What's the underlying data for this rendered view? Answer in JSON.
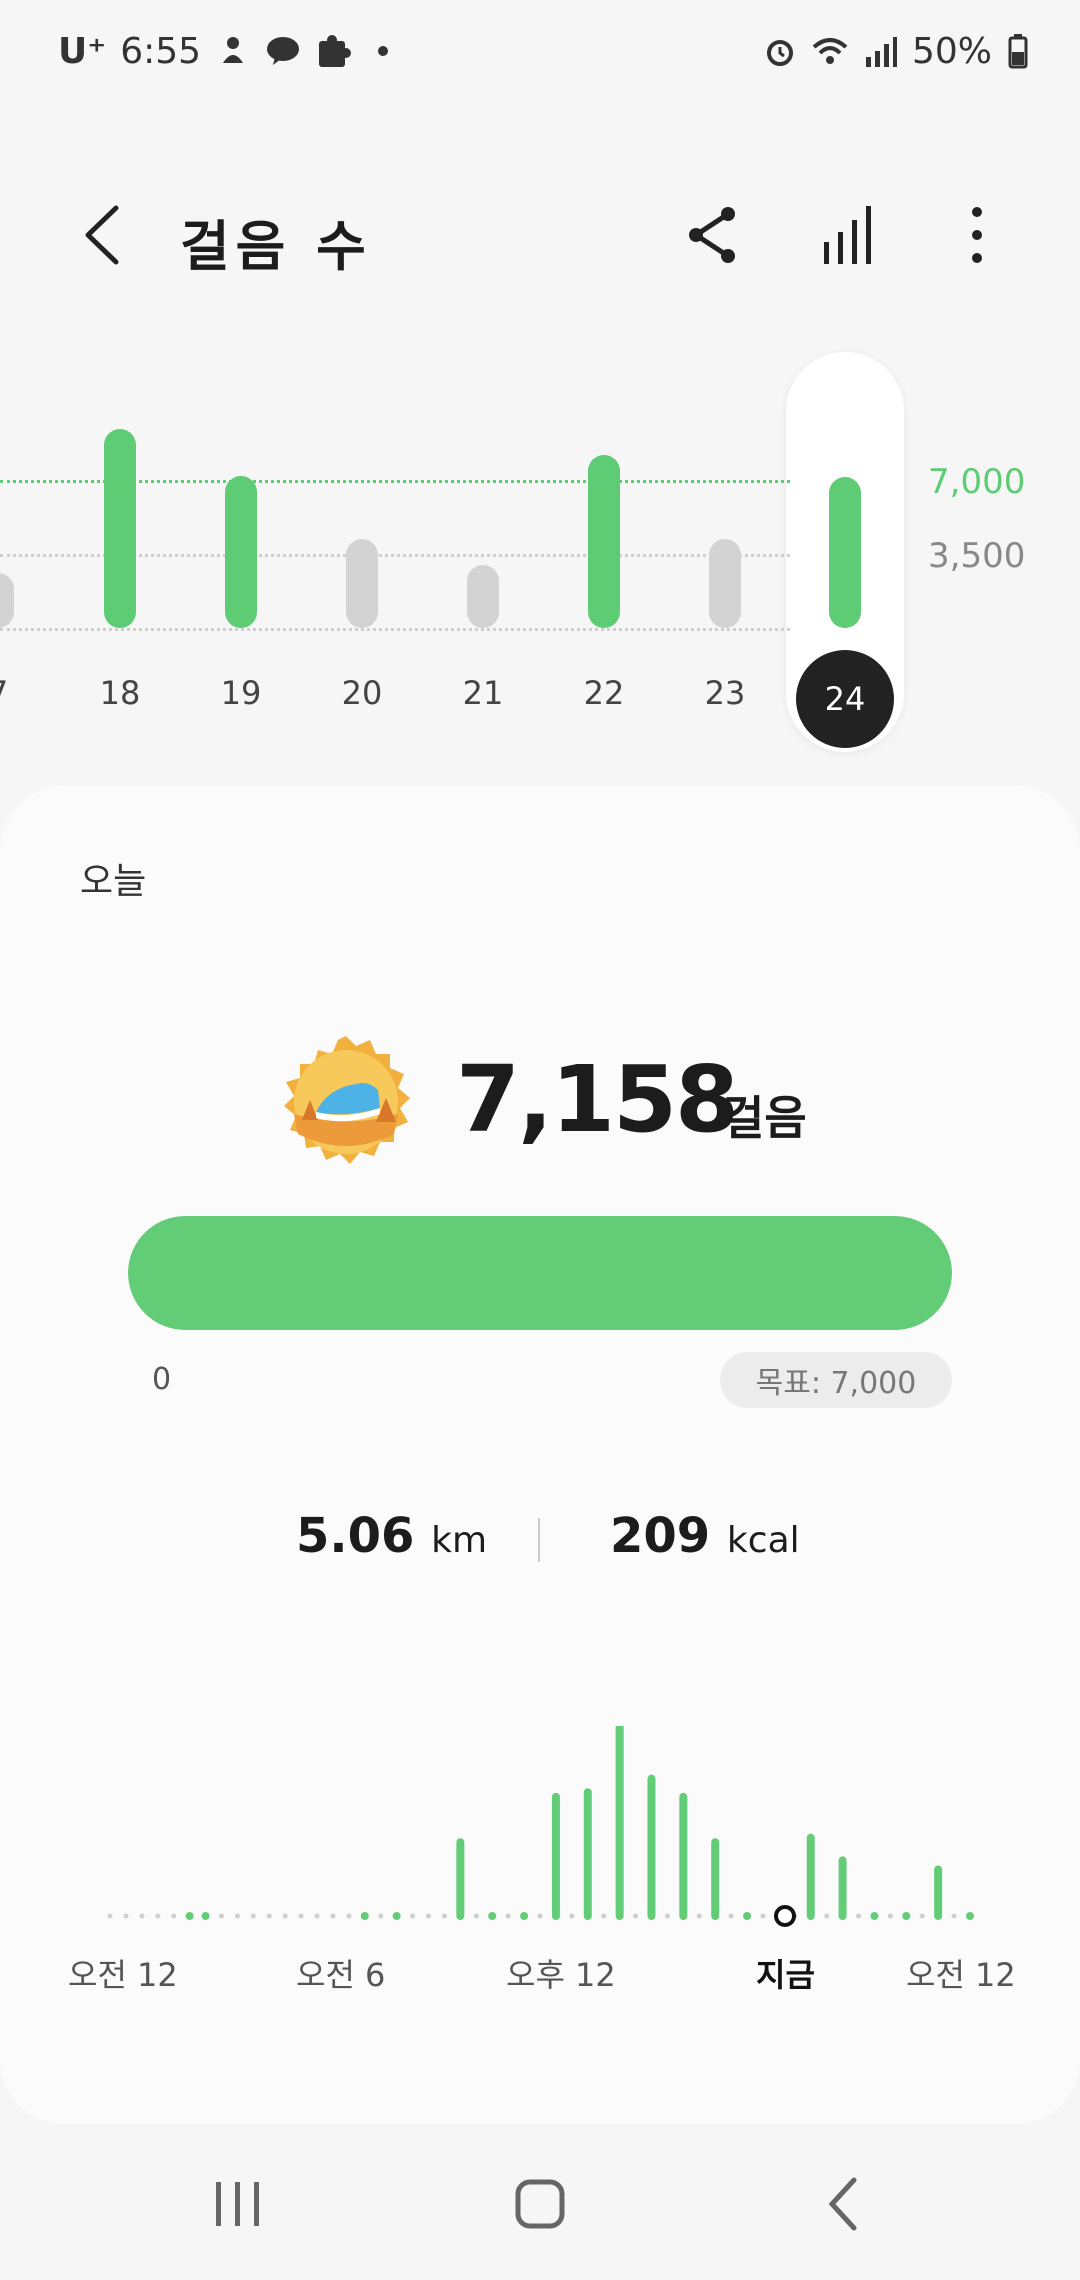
{
  "status_bar": {
    "carrier": "U⁺",
    "time": "6:55",
    "battery": "50%",
    "icons": [
      "assistant-icon",
      "talk-icon",
      "puzzle-icon",
      "dot-icon",
      "alarm-icon",
      "wifi-icon",
      "signal-icon",
      "battery-icon"
    ]
  },
  "header": {
    "title": "걸음 수",
    "back_icon": "chevron-left-icon",
    "actions": [
      "share-icon",
      "bar-chart-icon",
      "more-vert-icon"
    ]
  },
  "weekly": {
    "y_labels": [
      "7,000",
      "3,500"
    ],
    "days": [
      {
        "label": "7",
        "value": 2600,
        "met_goal": false
      },
      {
        "label": "18",
        "value": 9400,
        "met_goal": true
      },
      {
        "label": "19",
        "value": 7200,
        "met_goal": true
      },
      {
        "label": "20",
        "value": 4200,
        "met_goal": false
      },
      {
        "label": "21",
        "value": 3000,
        "met_goal": false
      },
      {
        "label": "22",
        "value": 8200,
        "met_goal": true
      },
      {
        "label": "23",
        "value": 4200,
        "met_goal": false
      },
      {
        "label": "24",
        "value": 7158,
        "met_goal": true,
        "selected": true
      }
    ],
    "colors": {
      "goal": "#5dcc74",
      "below": "#d3d3d3",
      "selected_bg": "#222222"
    }
  },
  "summary": {
    "period_label": "오늘",
    "steps": "7,158",
    "steps_unit": "걸음",
    "progress_fraction": 1.0,
    "progress_start": "0",
    "goal_label": "목표: 7,000",
    "distance_value": "5.06",
    "distance_unit": "km",
    "calories_value": "209",
    "calories_unit": "kcal"
  },
  "daily": {
    "x_labels": [
      "오전 12",
      "오전 6",
      "오후 12",
      "지금",
      "오전 12"
    ],
    "hourly_steps": [
      0,
      0,
      0,
      0,
      0,
      20,
      20,
      0,
      0,
      0,
      0,
      0,
      0,
      0,
      0,
      0,
      20,
      0,
      20,
      0,
      0,
      0,
      900,
      0,
      20,
      0,
      20,
      0,
      1400,
      0,
      1450,
      0,
      2400,
      0,
      1600,
      0,
      1400,
      0,
      900,
      0,
      20,
      0,
      20,
      0,
      950,
      0,
      700,
      0,
      20,
      0,
      20,
      0,
      600,
      0,
      20
    ]
  }
}
